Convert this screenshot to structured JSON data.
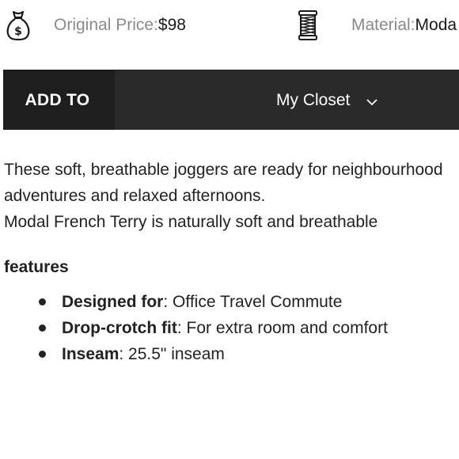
{
  "info": {
    "price_label": "Original Price:",
    "price_value": " $98",
    "material_label": "Material:",
    "material_value": " Moda"
  },
  "icons": {
    "price": "money-bag-icon",
    "material": "fabric-spool-icon",
    "dropdown": "chevron-down-icon"
  },
  "add_bar": {
    "label": "ADD TO",
    "selected": "My Closet"
  },
  "description": {
    "line1": "These soft, breathable joggers are ready for neighbourhood",
    "line2": "adventures and relaxed afternoons.",
    "line3": "Modal French Terry is naturally soft and breathable"
  },
  "features": {
    "title": "features",
    "items": [
      {
        "key": "Designed for",
        "value": ": Office Travel Commute"
      },
      {
        "key": "Drop-crotch fit",
        "value": ": For extra room and comfort"
      },
      {
        "key": "Inseam",
        "value": ": 25.5\" inseam"
      }
    ]
  },
  "colors": {
    "bar_background": "#2a2a2a",
    "label_background": "#1e1e1e",
    "label_text": "#ffffff",
    "muted_text": "#8a8a8a",
    "body_text": "#222222"
  }
}
